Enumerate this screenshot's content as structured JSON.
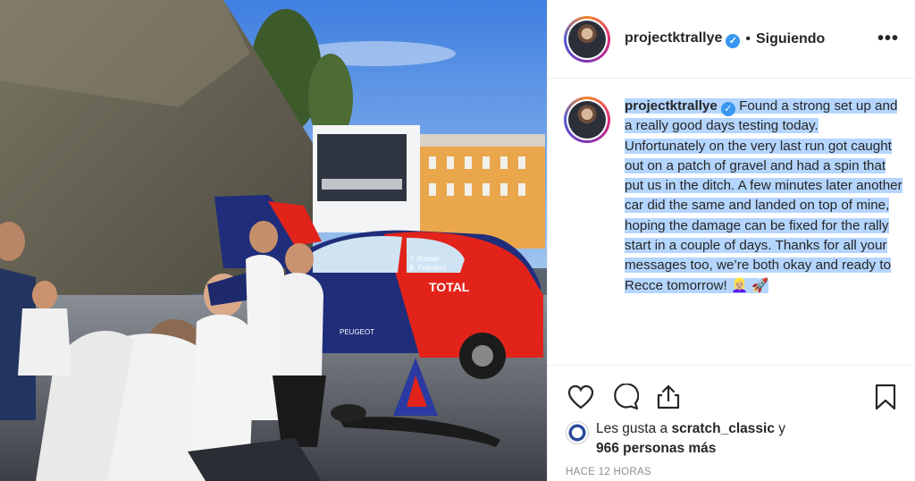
{
  "post": {
    "username": "projectktrallye",
    "separator": "•",
    "follow_status": "Siguiendo",
    "more_label": "•••",
    "caption": {
      "username": "projectktrallye",
      "text": "Found a strong set up and a really good days testing today. Unfortunately on the very last run got caught out on a patch of gravel and had a spin that put us in the ditch. A few minutes later another car did the same and landed on top of mine, hoping the damage can be fixed for the rally start in a couple of days. Thanks for all your messages too, we’re both okay and ready to Recce tomorrow! 👱🏼‍♀️ 🚀"
    },
    "likes": {
      "prefix": "Les gusta a",
      "liker": "scratch_classic",
      "conj": "y",
      "others": "966 personas más"
    },
    "timestamp": "HACE 12 HORAS"
  },
  "photo": {
    "car_brand_text": "TOTAL",
    "peugeot_text": "PEUGEOT",
    "driver_names": [
      "Y. Rossel",
      "B. Fulcrand"
    ]
  },
  "icons": [
    "heart-icon",
    "comment-icon",
    "share-icon",
    "bookmark-icon",
    "verified-badge-icon"
  ],
  "colors": {
    "verified": "#3897f0",
    "highlight": "#b4d5fe",
    "muted": "#8e8e8e"
  }
}
